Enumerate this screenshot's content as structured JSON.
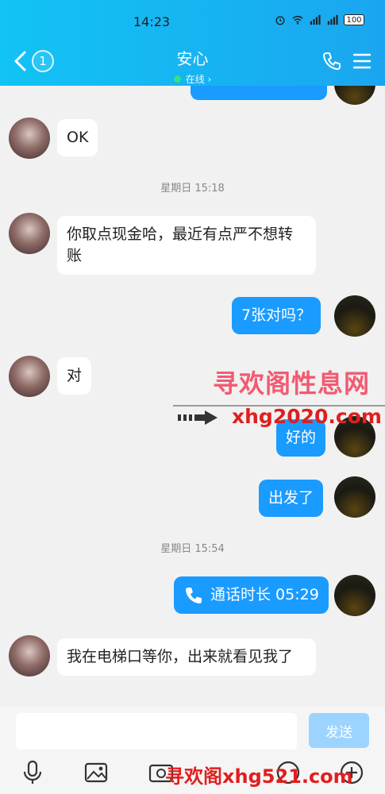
{
  "status": {
    "time": "14:23",
    "battery": "100"
  },
  "header": {
    "back_count": "1",
    "title": "安心",
    "presence": "在线 ›"
  },
  "messages": {
    "m1": "OK",
    "ts1": "星期日 15:18",
    "m2": "你取点现金哈，最近有点严不想转账",
    "m3": "7张对吗？",
    "m4": "对",
    "m5": "好的",
    "m6": "出发了",
    "ts2": "星期日 15:54",
    "m7": "通话时长 05:29",
    "m8": "我在电梯口等你，出来就看见我了"
  },
  "watermark": {
    "line1": "寻欢阁性息网",
    "line2": "xhg2020.com",
    "line3": "寻欢阁xhg521.com"
  },
  "input": {
    "placeholder": "",
    "send_label": "发送"
  },
  "colors": {
    "header_start": "#12c3f5",
    "header_end": "#1aa6ef",
    "outgoing_bubble": "#1a9bff",
    "send_disabled": "#9dd4ff"
  }
}
